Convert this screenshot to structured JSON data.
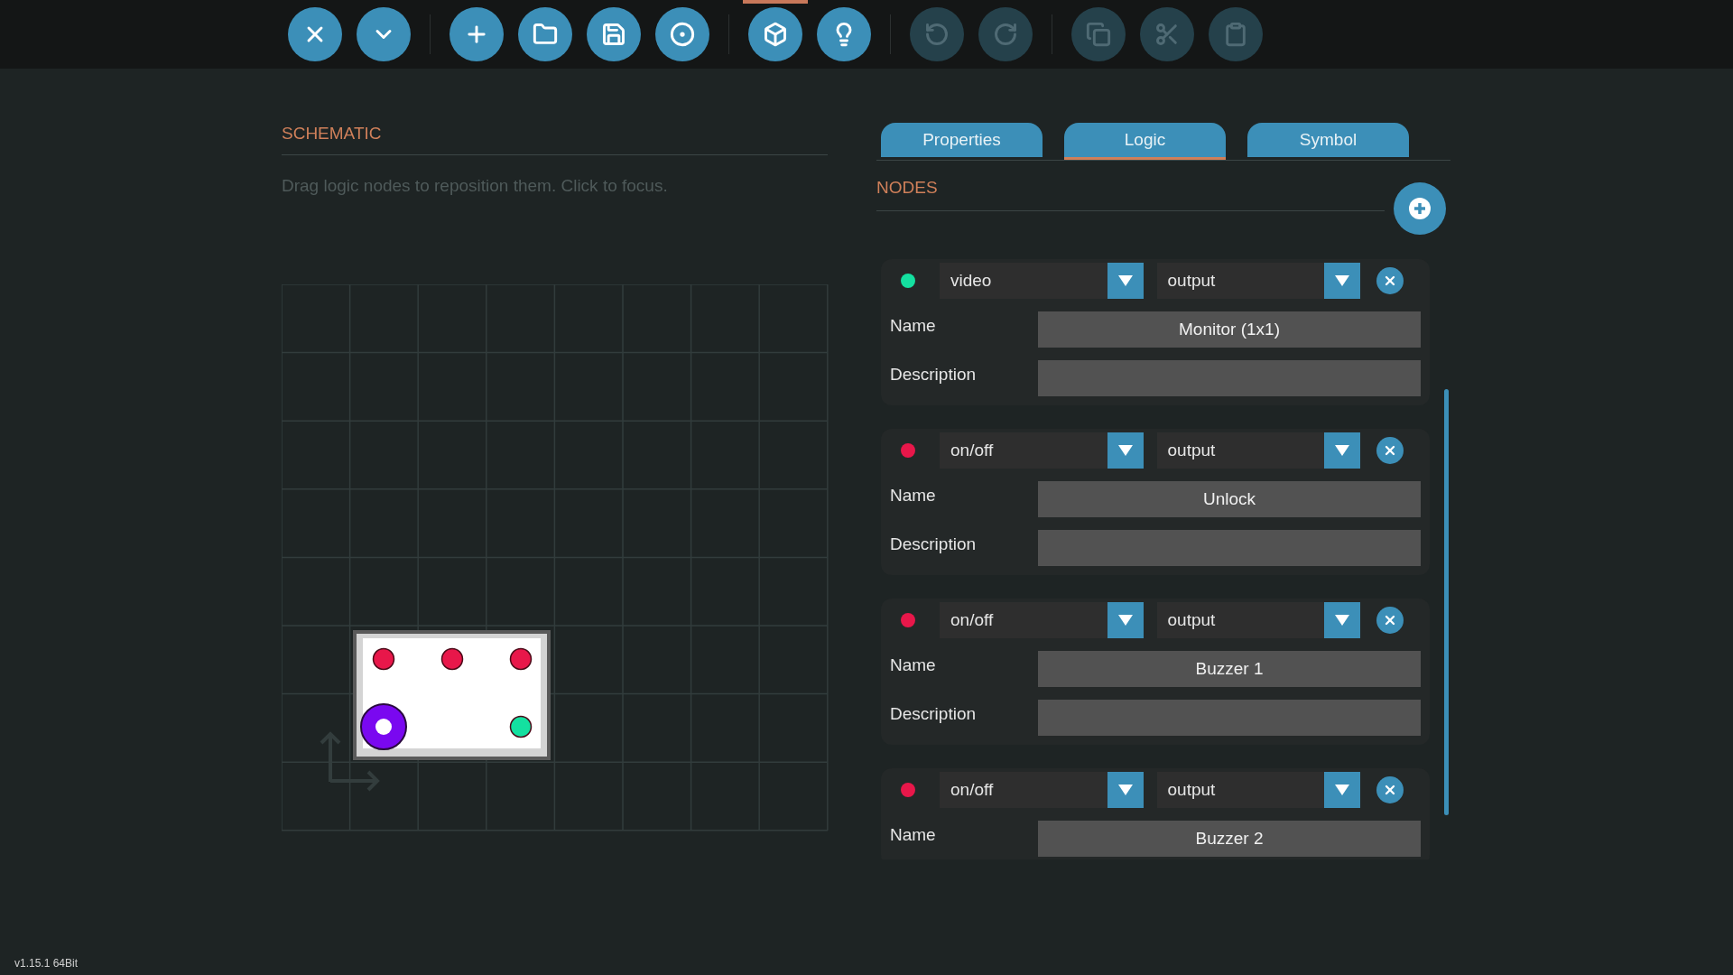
{
  "toolbar": {
    "groups": [
      [
        {
          "disabled": false,
          "selected": false
        },
        {
          "disabled": false,
          "selected": false
        }
      ],
      [
        {
          "disabled": false,
          "selected": false
        },
        {
          "disabled": false,
          "selected": false
        },
        {
          "disabled": false,
          "selected": false
        },
        {
          "disabled": false,
          "selected": false
        }
      ],
      [
        {
          "disabled": false,
          "selected": true
        },
        {
          "disabled": false,
          "selected": false
        }
      ],
      [
        {
          "disabled": true,
          "selected": false
        },
        {
          "disabled": true,
          "selected": false
        }
      ],
      [
        {
          "disabled": true,
          "selected": false
        },
        {
          "disabled": true,
          "selected": false
        },
        {
          "disabled": true,
          "selected": false
        }
      ]
    ]
  },
  "schematic": {
    "title": "SCHEMATIC",
    "hint": "Drag logic nodes to reposition them. Click to focus.",
    "pins": [
      {
        "color": "#e8174a"
      },
      {
        "color": "#e8174a"
      },
      {
        "color": "#e8174a"
      },
      {
        "color": "#14e0a0"
      }
    ]
  },
  "tabs": [
    {
      "label": "Properties",
      "selected": false
    },
    {
      "label": "Logic",
      "selected": true
    },
    {
      "label": "Symbol",
      "selected": false
    }
  ],
  "nodes_panel": {
    "title": "NODES",
    "nodes": [
      {
        "color": "#14e0a0",
        "type": "video",
        "direction": "output",
        "name_label": "Name",
        "name": "Monitor (1x1)",
        "description_label": "Description"
      },
      {
        "color": "#e8174a",
        "type": "on/off",
        "direction": "output",
        "name_label": "Name",
        "name": "Unlock",
        "description_label": "Description"
      },
      {
        "color": "#e8174a",
        "type": "on/off",
        "direction": "output",
        "name_label": "Name",
        "name": "Buzzer 1",
        "description_label": "Description"
      },
      {
        "color": "#e8174a",
        "type": "on/off",
        "direction": "output",
        "name_label": "Name",
        "name": "Buzzer 2"
      }
    ]
  },
  "status": {
    "version": "v1.15.1 64Bit"
  }
}
